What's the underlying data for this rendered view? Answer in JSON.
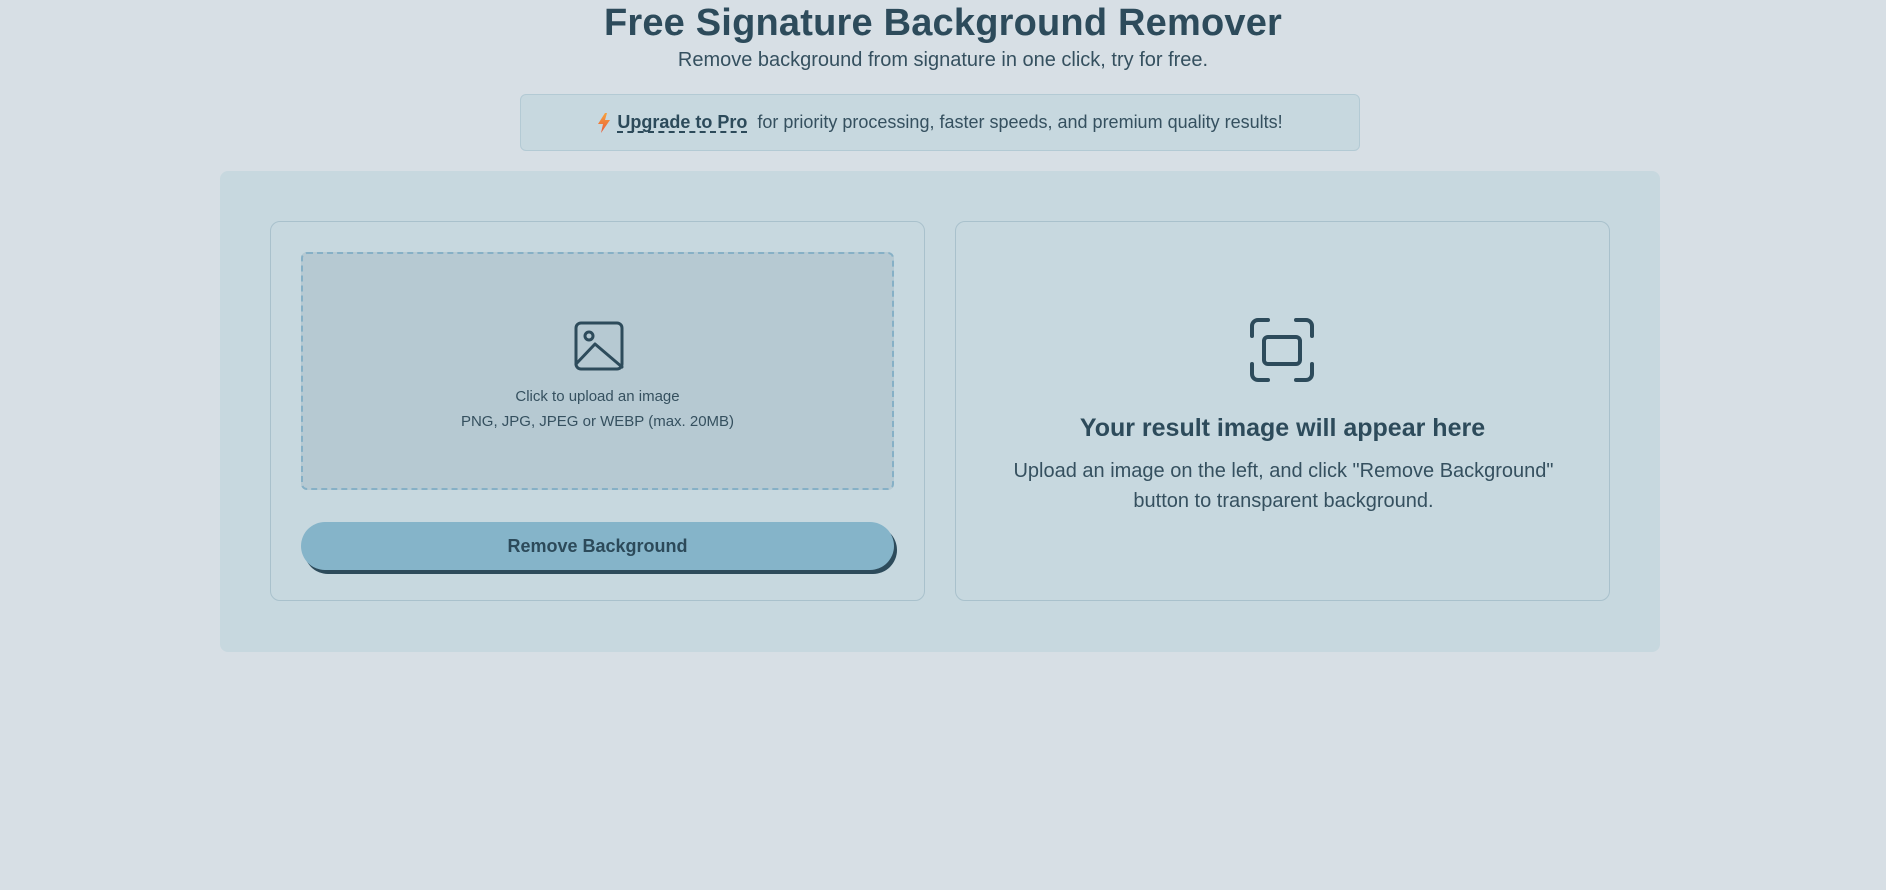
{
  "header": {
    "title": "Free Signature Background Remover",
    "subtitle": "Remove background from signature in one click, try for free."
  },
  "promo": {
    "icon": "lightning-bolt-icon",
    "link_label": "Upgrade to Pro",
    "text": "for priority processing, faster speeds, and premium quality results!",
    "bolt_colors": [
      "#f7a23b",
      "#e8593a"
    ]
  },
  "upload": {
    "icon": "image-icon",
    "label": "Click to upload an image",
    "hint": "PNG, JPG, JPEG or WEBP (max. 20MB)",
    "button_label": "Remove Background"
  },
  "result": {
    "icon": "scan-frame-icon",
    "title": "Your result image will appear here",
    "description": "Upload an image on the left, and click \"Remove Background\" button to transparent background."
  },
  "colors": {
    "page_bg": "#d7dfe5",
    "panel_bg": "#c7d8df",
    "dropzone_bg": "#b6c9d2",
    "accent": "#85b4c9",
    "text": "#2d4b5b"
  }
}
